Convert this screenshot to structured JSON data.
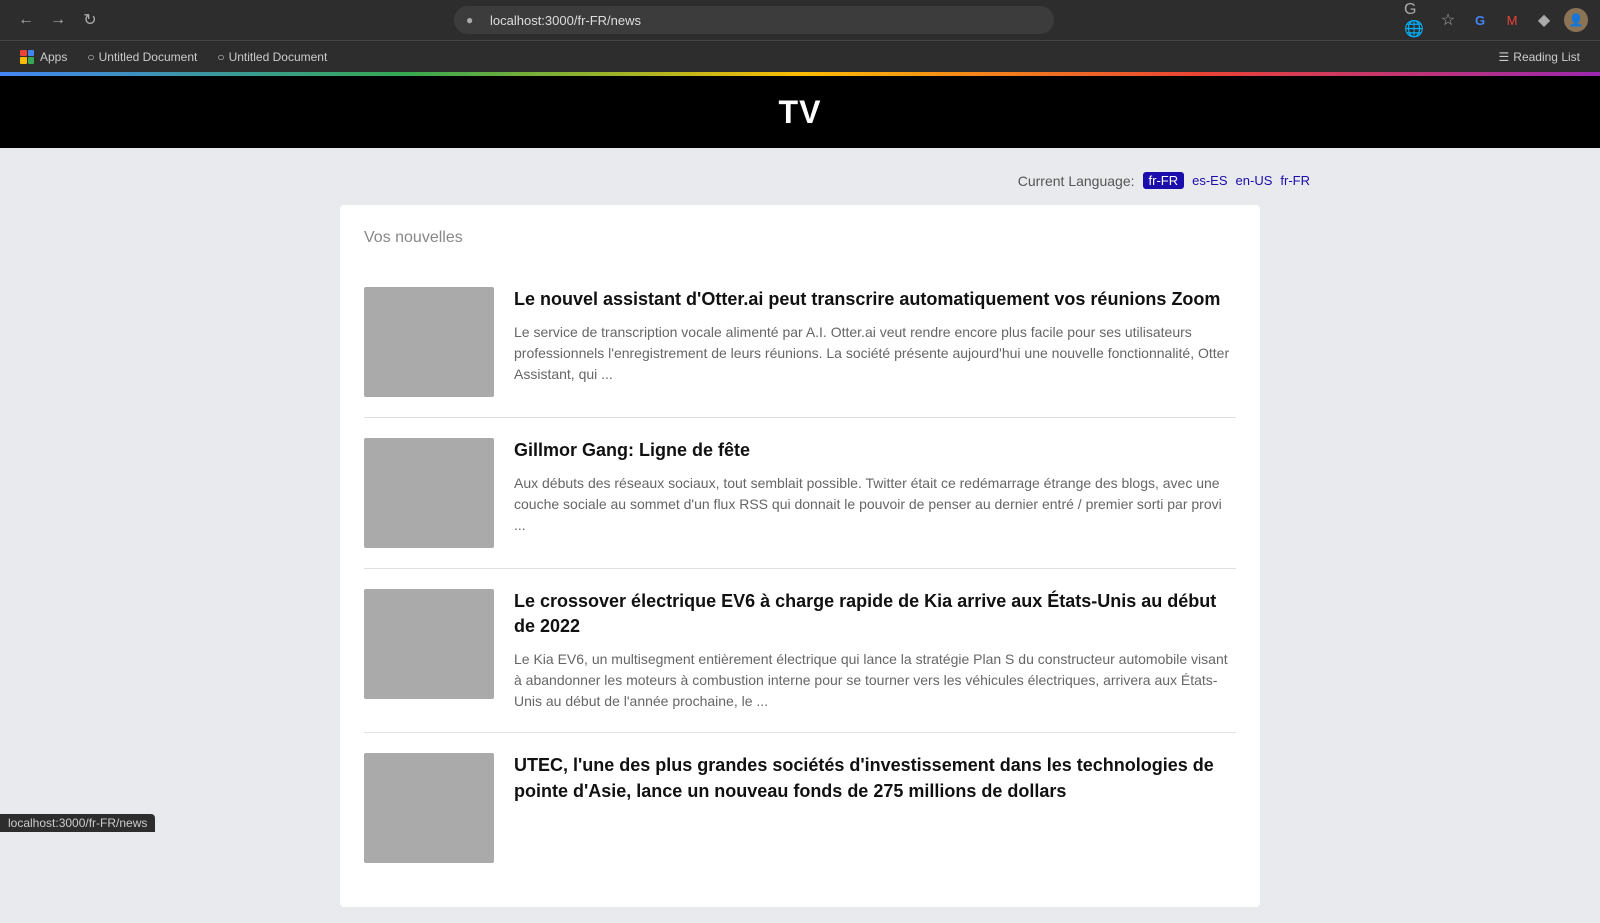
{
  "browser": {
    "url": "localhost:3000/fr-FR/news",
    "bookmarks": [
      {
        "label": "Apps"
      },
      {
        "label": "Untitled Document"
      },
      {
        "label": "Untitled Document"
      }
    ],
    "reading_list_label": "Reading List"
  },
  "site": {
    "title": "TV"
  },
  "language_bar": {
    "label": "Current Language:",
    "current": "fr-FR",
    "options": [
      "es-ES",
      "en-US",
      "fr-FR"
    ]
  },
  "news": {
    "section_title": "Vos nouvelles",
    "articles": [
      {
        "title": "Le nouvel assistant d'Otter.ai peut transcrire automatiquement vos réunions Zoom",
        "summary": "Le service de transcription vocale alimenté par A.I. Otter.ai veut rendre encore plus facile pour ses utilisateurs professionnels l'enregistrement de leurs réunions. La société présente aujourd'hui une nouvelle fonctionnalité, Otter Assistant, qui ..."
      },
      {
        "title": "Gillmor Gang: Ligne de fête",
        "summary": "Aux débuts des réseaux sociaux, tout semblait possible. Twitter était ce redémarrage étrange des blogs, avec une couche sociale au sommet d'un flux RSS qui donnait le pouvoir de penser au dernier entré / premier sorti par provi ..."
      },
      {
        "title": "Le crossover électrique EV6 à charge rapide de Kia arrive aux États-Unis au début de 2022",
        "summary": "Le Kia EV6, un multisegment entièrement électrique qui lance la stratégie Plan S du constructeur automobile visant à abandonner les moteurs à combustion interne pour se tourner vers les véhicules électriques, arrivera aux États-Unis au début de l'année prochaine, le ..."
      },
      {
        "title": "UTEC, l'une des plus grandes sociétés d'investissement dans les technologies de pointe d'Asie, lance un nouveau fonds de 275 millions de dollars",
        "summary": ""
      }
    ]
  },
  "status_bar": {
    "url": "localhost:3000/fr-FR/news"
  }
}
